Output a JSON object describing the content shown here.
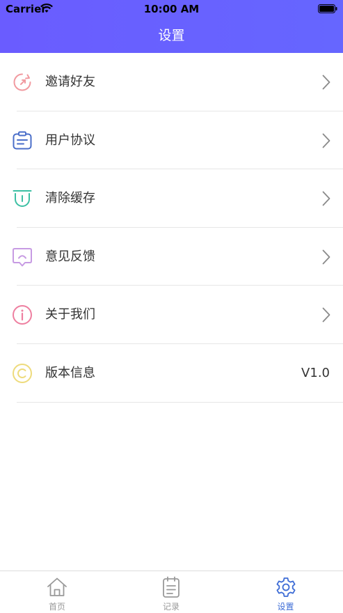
{
  "status_bar": {
    "carrier": "Carrier",
    "time": "10:00 AM"
  },
  "nav": {
    "title": "设置"
  },
  "settings": {
    "items": [
      {
        "label": "邀请好友",
        "icon": "refresh-icon",
        "color": "#f19aa0"
      },
      {
        "label": "用户协议",
        "icon": "clipboard-icon",
        "color": "#4a6ec9"
      },
      {
        "label": "清除缓存",
        "icon": "trash-icon",
        "color": "#3bbfa3"
      },
      {
        "label": "意见反馈",
        "icon": "feedback-icon",
        "color": "#c79be3"
      },
      {
        "label": "关于我们",
        "icon": "info-icon",
        "color": "#ee7fa0"
      },
      {
        "label": "版本信息",
        "icon": "copyright-icon",
        "color": "#eedb7c",
        "value": "V1.0"
      }
    ]
  },
  "tabbar": {
    "tabs": [
      {
        "label": "首页",
        "icon": "home-icon",
        "active": false
      },
      {
        "label": "记录",
        "icon": "document-icon",
        "active": false
      },
      {
        "label": "设置",
        "icon": "gear-icon",
        "active": true
      }
    ],
    "active_color": "#3d6cd6",
    "inactive_color": "#999999"
  },
  "colors": {
    "header_gradient_start": "#6a5cff",
    "header_gradient_end": "#6666ff"
  }
}
